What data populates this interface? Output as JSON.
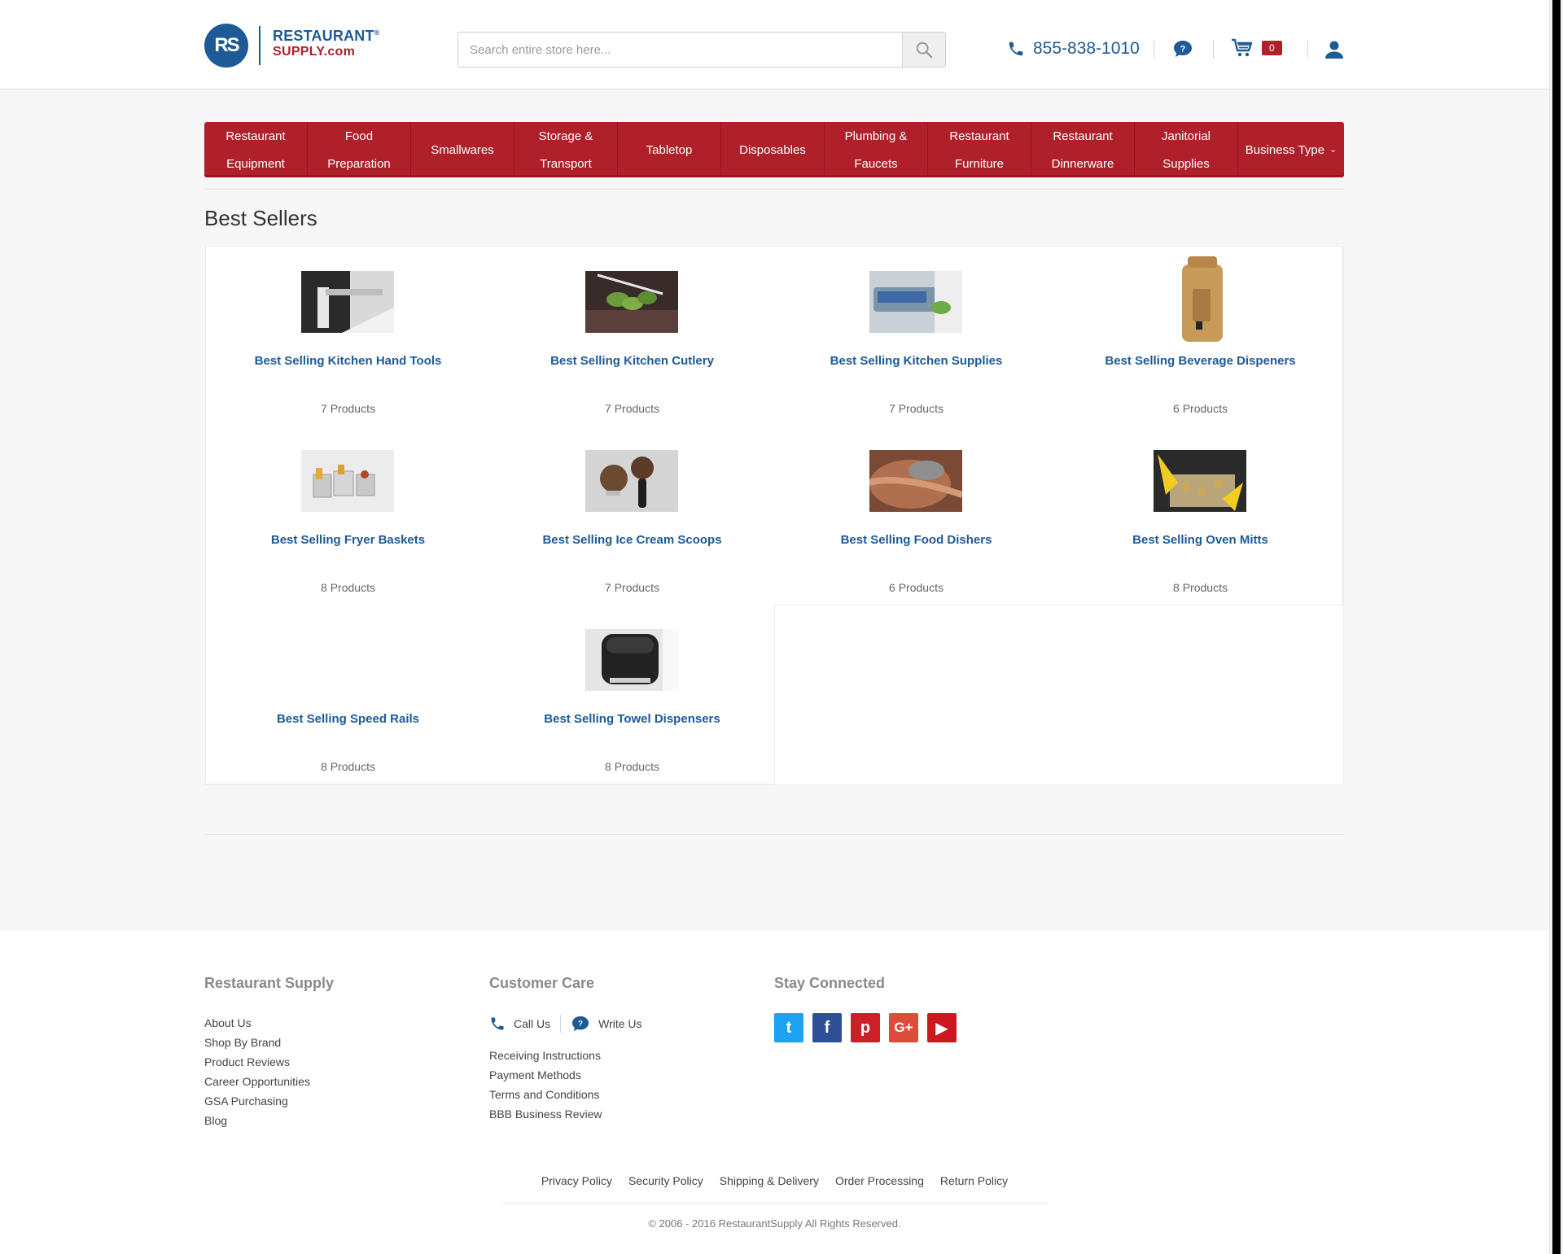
{
  "header": {
    "logo_mark": "RS",
    "logo_line1": "RESTAURANT",
    "logo_reg": "®",
    "logo_line2": "SUPPLY.com",
    "search_placeholder": "Search entire store here...",
    "phone": "855-838-1010",
    "cart_count": "0",
    "brand_color": "#b0202a",
    "accent_color": "#1d5a96"
  },
  "nav": {
    "items": [
      {
        "l1": "Restaurant",
        "l2": "Equipment"
      },
      {
        "l1": "Food",
        "l2": "Preparation"
      },
      {
        "l1": "Smallwares",
        "l2": ""
      },
      {
        "l1": "Storage &",
        "l2": "Transport"
      },
      {
        "l1": "Tabletop",
        "l2": ""
      },
      {
        "l1": "Disposables",
        "l2": ""
      },
      {
        "l1": "Plumbing &",
        "l2": "Faucets"
      },
      {
        "l1": "Restaurant",
        "l2": "Furniture"
      },
      {
        "l1": "Restaurant",
        "l2": "Dinnerware"
      },
      {
        "l1": "Janitorial",
        "l2": "Supplies"
      }
    ],
    "business_type": "Business Type"
  },
  "page": {
    "title": "Best Sellers"
  },
  "categories": [
    {
      "name": "Best Selling Kitchen Hand Tools",
      "count": "7 Products"
    },
    {
      "name": "Best Selling Kitchen Cutlery",
      "count": "7 Products"
    },
    {
      "name": "Best Selling Kitchen Supplies",
      "count": "7 Products"
    },
    {
      "name": "Best Selling Beverage Dispeners",
      "count": "6 Products"
    },
    {
      "name": "Best Selling Fryer Baskets",
      "count": "8 Products"
    },
    {
      "name": "Best Selling Ice Cream Scoops",
      "count": "7 Products"
    },
    {
      "name": "Best Selling Food Dishers",
      "count": "6 Products"
    },
    {
      "name": "Best Selling Oven Mitts",
      "count": "8 Products"
    },
    {
      "name": "Best Selling Speed Rails",
      "count": "8 Products"
    },
    {
      "name": "Best Selling Towel Dispensers",
      "count": "8 Products"
    }
  ],
  "footer": {
    "col1": {
      "title": "Restaurant Supply",
      "links": [
        "About Us",
        "Shop By Brand",
        "Product Reviews",
        "Career Opportunities",
        "GSA Purchasing",
        "Blog"
      ]
    },
    "col2": {
      "title": "Customer Care",
      "call": "Call Us",
      "write": "Write Us",
      "links": [
        "Receiving Instructions",
        "Payment Methods",
        "Terms and Conditions",
        "BBB Business Review"
      ]
    },
    "col3": {
      "title": "Stay Connected",
      "socials": [
        {
          "icon": "twitter-icon",
          "glyph": "t",
          "color": "#1da1f2"
        },
        {
          "icon": "facebook-icon",
          "glyph": "f",
          "color": "#2d4f95"
        },
        {
          "icon": "pinterest-icon",
          "glyph": "p",
          "color": "#cb2027"
        },
        {
          "icon": "google-plus-icon",
          "glyph": "G+",
          "color": "#dd4b39"
        },
        {
          "icon": "youtube-icon",
          "glyph": "▶",
          "color": "#cc181e"
        }
      ]
    },
    "bottom_links": [
      "Privacy Policy",
      "Security Policy",
      "Shipping & Delivery",
      "Order Processing",
      "Return Policy"
    ],
    "copyright": "© 2006 - 2016 RestaurantSupply All Rights Reserved."
  }
}
